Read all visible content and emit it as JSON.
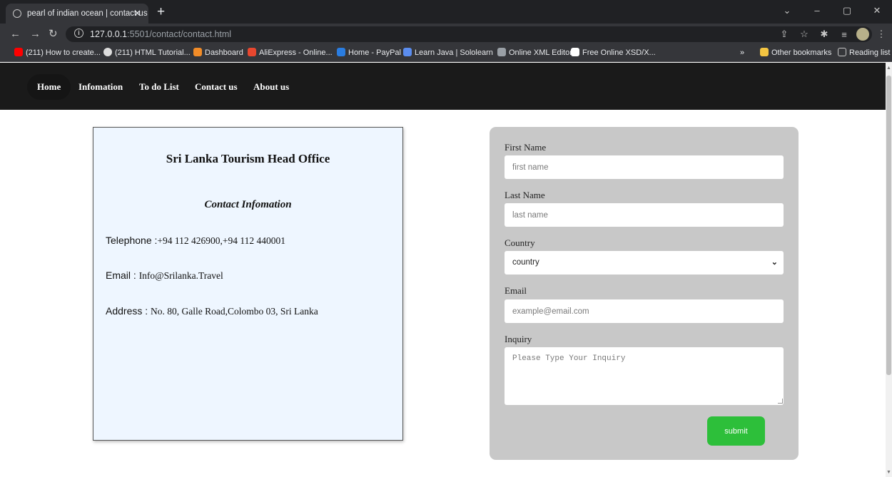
{
  "browser": {
    "tab_title": "pearl of indian ocean | contact us",
    "tab_close": "✕",
    "new_tab": "+",
    "url_host": "127.0.0.1",
    "url_port": ":5501",
    "url_path": "/contact/contact.html",
    "bookmarks": [
      {
        "label": "(211) How to create...",
        "color": "#ff0000"
      },
      {
        "label": "(211) HTML Tutorial...",
        "color": "#dddddd"
      },
      {
        "label": "Dashboard",
        "color": "#f28c28"
      },
      {
        "label": "AliExpress - Online...",
        "color": "#e8472f"
      },
      {
        "label": "Home - PayPal",
        "color": "#2a7de1"
      },
      {
        "label": "Learn Java | Sololearn",
        "color": "#5b8def"
      },
      {
        "label": "Online XML Editor",
        "color": "#9aa0a6"
      },
      {
        "label": "Free Online XSD/X...",
        "color": "#ffffff"
      }
    ],
    "bookmarks_overflow": "»",
    "other_bookmarks": "Other bookmarks",
    "reading_list": "Reading list"
  },
  "nav": {
    "items": [
      "Home",
      "Infomation",
      "To do List",
      "Contact us",
      "About us"
    ]
  },
  "info": {
    "title": "Sri Lanka Tourism Head Office",
    "subtitle": "Contact Infomation",
    "telephone_label": "Telephone :",
    "telephone_value": "+94 112 426900,+94 112 440001",
    "email_label": "Email : ",
    "email_value": "Info@Srilanka.Travel",
    "address_label": "Address : ",
    "address_value": "No. 80, Galle Road,Colombo 03, Sri Lanka"
  },
  "form": {
    "first_name_label": "First Name",
    "first_name_placeholder": "first name",
    "last_name_label": "Last Name",
    "last_name_placeholder": "last name",
    "country_label": "Country",
    "country_value": "country",
    "email_label": "Email",
    "email_placeholder": "example@email.com",
    "inquiry_label": "Inquiry",
    "inquiry_placeholder": "Please Type Your Inquiry",
    "submit_label": "submit"
  }
}
